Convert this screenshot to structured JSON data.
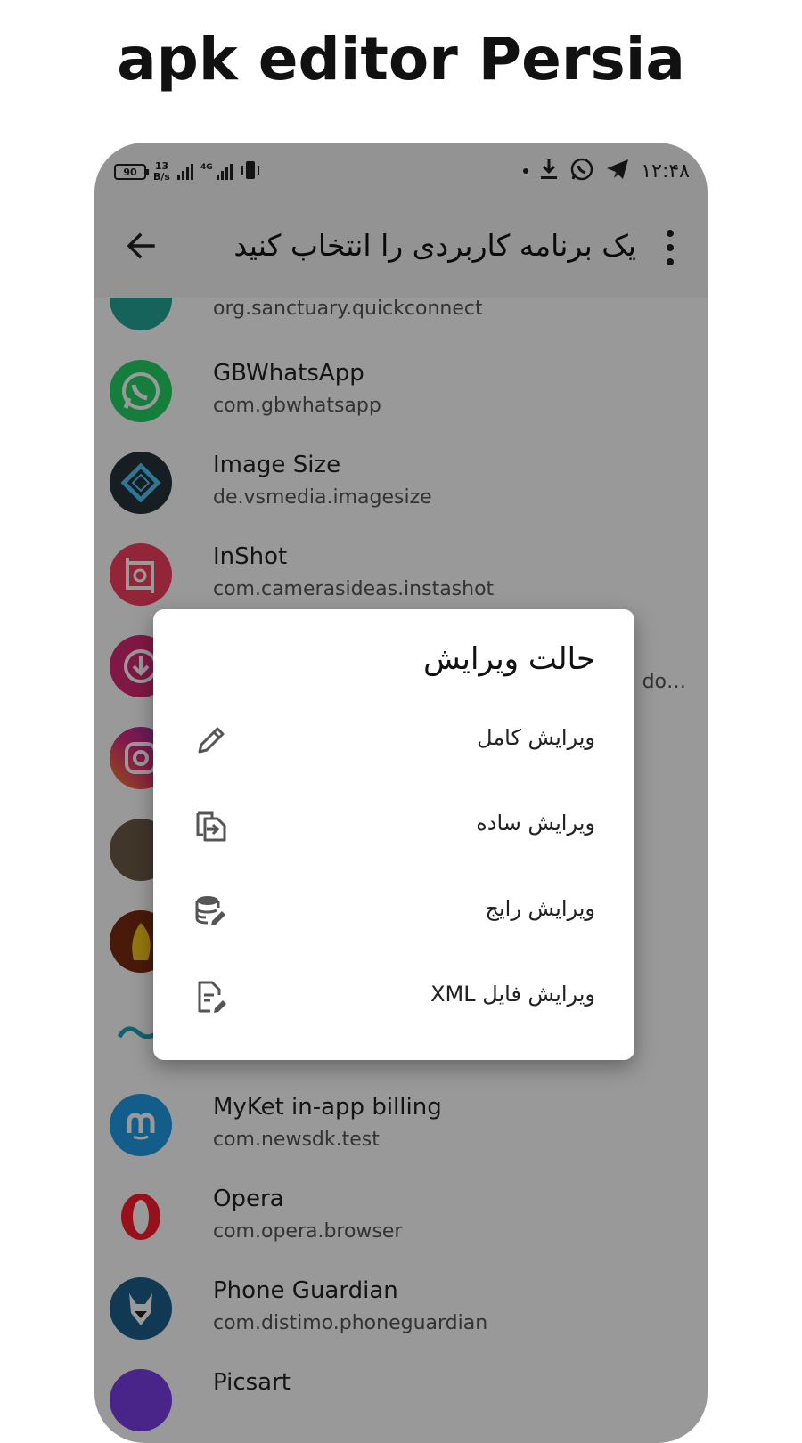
{
  "promo": {
    "title": "apk editor Persia"
  },
  "statusbar": {
    "battery": "90",
    "net_speed_value": "13",
    "net_speed_unit": "B/s",
    "network_type": "4G",
    "clock": "۱۲:۴۸",
    "icons": [
      "battery-icon",
      "signal-icon",
      "vibrate-icon",
      "notification-dot-icon",
      "download-icon",
      "whatsapp-icon",
      "telegram-icon"
    ]
  },
  "appbar": {
    "title": "یک برنامه کاربردی را انتخاب کنید"
  },
  "apps": [
    {
      "name": "",
      "package": "org.sanctuary.quickconnect",
      "color": "#26a69a"
    },
    {
      "name": "GBWhatsApp",
      "package": "com.gbwhatsapp",
      "color": "#25d366"
    },
    {
      "name": "Image Size",
      "package": "de.vsmedia.imagesize",
      "color": "#263238"
    },
    {
      "name": "InShot",
      "package": "com.camerasideas.instashot",
      "color": "#f43f5e"
    },
    {
      "name": "",
      "package": "",
      "tail": "do…",
      "color": "#d62976"
    },
    {
      "name": "",
      "package": "",
      "color": "#c13584"
    },
    {
      "name": "",
      "package": "",
      "color": "#6d5a46"
    },
    {
      "name": "",
      "package": "",
      "color": "#7a2a10"
    },
    {
      "name": "",
      "package": "",
      "color": "#ffffff"
    },
    {
      "name": "MyKet in-app billing",
      "package": "com.newsdk.test",
      "color": "#1e9be6"
    },
    {
      "name": "Opera",
      "package": "com.opera.browser",
      "color": "#ffffff"
    },
    {
      "name": "Phone Guardian",
      "package": "com.distimo.phoneguardian",
      "color": "#1f5f8b"
    },
    {
      "name": "Picsart",
      "package": "",
      "color": "#7b3fe4"
    }
  ],
  "dialog": {
    "title": "حالت ویرایش",
    "options": [
      {
        "label": "ویرایش کامل",
        "icon": "pencil-icon"
      },
      {
        "label": "ویرایش ساده",
        "icon": "file-import-icon"
      },
      {
        "label": "ویرایش رایج",
        "icon": "database-edit-icon"
      },
      {
        "label": "ویرایش فایل XML",
        "icon": "file-edit-icon"
      }
    ]
  }
}
